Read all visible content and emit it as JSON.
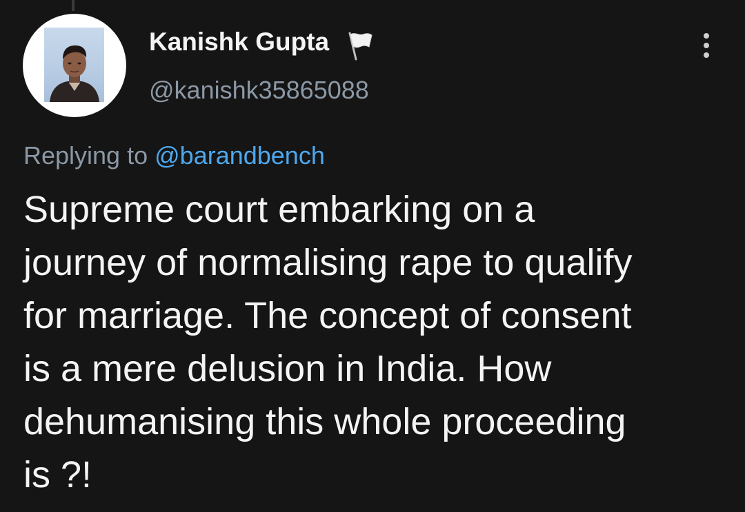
{
  "tweet": {
    "author": {
      "name": "Kanishk Gupta",
      "handle": "@kanishk35865088",
      "badge_icon": "white-flag-icon"
    },
    "menu_icon": "more-vertical-icon",
    "replying_to": {
      "prefix": "Replying to",
      "mention": "@barandbench"
    },
    "body_lines": [
      "Supreme court embarking on a",
      "journey of normalising rape to qualify",
      "for marriage. The concept of consent",
      "is a mere delusion in India. How",
      "dehumanising this whole proceeding",
      "is ?!"
    ]
  },
  "colors": {
    "background": "#151515",
    "primary_text": "#f4f4f4",
    "secondary_text": "#8b98a5",
    "link": "#4ea8ee"
  }
}
